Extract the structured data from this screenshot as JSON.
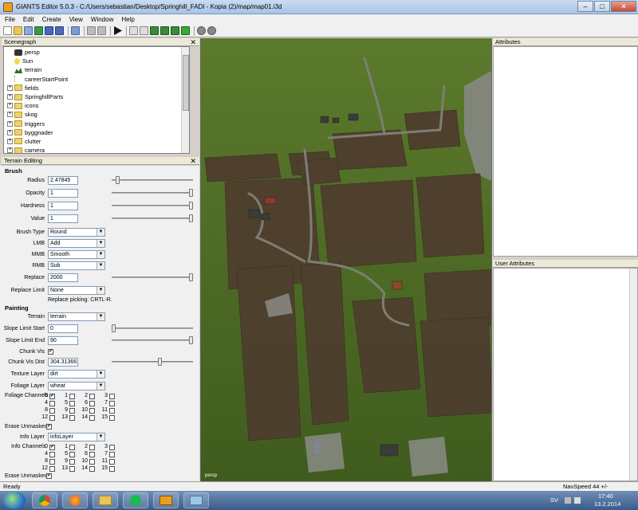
{
  "window": {
    "title": "GIANTS Editor 5.0.3 - C:/Users/sebastian/Desktop/Springhill_FADI - Kopia (2)/map/map01.i3d",
    "min": "–",
    "max": "□",
    "close": "✕"
  },
  "menu": [
    "File",
    "Edit",
    "Create",
    "View",
    "Window",
    "Help"
  ],
  "scenegraph": {
    "title": "Scenegraph",
    "items": [
      {
        "label": "persp",
        "icon": "camera-icon"
      },
      {
        "label": "Sun",
        "icon": "light-bulb-icon"
      },
      {
        "label": "terrain",
        "icon": "terrain-icon"
      },
      {
        "label": "careerStartPoint",
        "icon": "node-icon"
      },
      {
        "label": "fields",
        "icon": "folder-icon"
      },
      {
        "label": "SpringhillParts",
        "icon": "folder-icon"
      },
      {
        "label": "icons",
        "icon": "folder-icon"
      },
      {
        "label": "skog",
        "icon": "folder-icon"
      },
      {
        "label": "triggers",
        "icon": "folder-icon"
      },
      {
        "label": "byggnader",
        "icon": "folder-icon"
      },
      {
        "label": "clutter",
        "icon": "folder-icon"
      },
      {
        "label": "camera",
        "icon": "folder-icon"
      }
    ]
  },
  "terrain": {
    "title": "Terrain Editing",
    "brush_title": "Brush",
    "radius_label": "Radius",
    "radius_value": "2.47845",
    "radius_level": 0.05,
    "opacity_label": "Opacity",
    "opacity_value": "1",
    "opacity_level": 1,
    "hardness_label": "Hardness",
    "hardness_value": "1",
    "hardness_level": 1,
    "value_label": "Value",
    "value_value": "1",
    "value_level": 1,
    "brushtype_label": "Brush Type",
    "brushtype_value": "Round",
    "lmb_label": "LMB",
    "lmb_value": "Add",
    "mmb_label": "MMB",
    "mmb_value": "Smooth",
    "rmb_label": "RMB",
    "rmb_value": "Sub",
    "replace_label": "Replace",
    "replace_value": "2000",
    "replace_level": 1,
    "replacelimit_label": "Replace Limit",
    "replacelimit_value": "None",
    "replace_hint": "Replace picking: CRTL-R.",
    "painting_title": "Painting",
    "paint_terrain_label": "Terrain",
    "paint_terrain_value": "terrain",
    "slopestart_label": "Slope Limit Start",
    "slopestart_value": "0",
    "slopestart_level": 0,
    "slopeend_label": "Slope Limit End",
    "slopeend_value": "90",
    "slopeend_level": 1,
    "chunkvis_label": "Chunk Vis",
    "check_mark": "✔",
    "chunkdist_label": "Chunk Vis Dist",
    "chunkdist_value": "304.31366",
    "chunkdist_level": 0.6,
    "texture_label": "Texture Layer",
    "texture_value": "dirt",
    "foliage_label": "Foliage Layer",
    "foliage_value": "wheat",
    "foliagech_label": "Foliage Channels",
    "erase1_label": "Erase Unmasked",
    "info_label": "Info Layer",
    "info_value": "infoLayer",
    "infoch_label": "Info Channels",
    "erase2_label": "Erase Unmasked",
    "channels": [
      "0",
      "1",
      "2",
      "3",
      "4",
      "5",
      "6",
      "7",
      "8",
      "9",
      "10",
      "11",
      "12",
      "13",
      "14",
      "15"
    ]
  },
  "viewport": {
    "label": "persp"
  },
  "attributes": {
    "title": "Attributes"
  },
  "user_attributes": {
    "title": "User Attributes"
  },
  "status": {
    "text": "Ready",
    "nav": "NavSpeed 44 +/-"
  },
  "tray": {
    "lang": "SV",
    "time": "17:40",
    "date": "13.2.2014"
  }
}
